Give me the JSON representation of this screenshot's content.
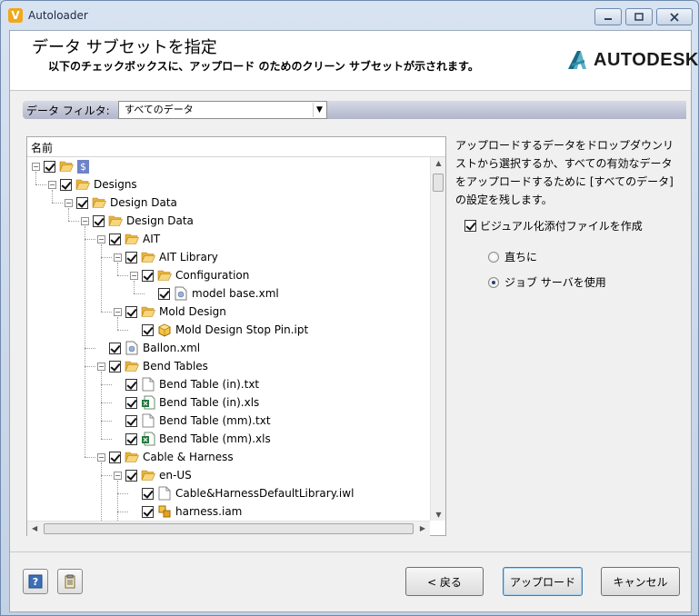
{
  "window": {
    "title": "Autoloader",
    "app_icon_letter": "V"
  },
  "header": {
    "title": "データ サブセットを指定",
    "subtitle": "以下のチェックボックスに、アップロード のためのクリーン サブセットが示されます。",
    "logo_text": "AUTODESK."
  },
  "filter": {
    "label": "データ フィルタ:",
    "selected": "すべてのデータ"
  },
  "tree": {
    "column_header": "名前",
    "nodes": [
      {
        "label": "$",
        "level": 0,
        "icon": "folder-open-icon",
        "expand": "minus"
      },
      {
        "label": "Designs",
        "level": 1,
        "icon": "folder-open-icon",
        "expand": "minus"
      },
      {
        "label": "Design Data",
        "level": 2,
        "icon": "folder-open-icon",
        "expand": "minus"
      },
      {
        "label": "Design Data",
        "level": 3,
        "icon": "folder-open-icon",
        "expand": "minus"
      },
      {
        "label": "AIT",
        "level": 4,
        "icon": "folder-open-icon",
        "expand": "minus"
      },
      {
        "label": "AIT Library",
        "level": 5,
        "icon": "folder-open-icon",
        "expand": "minus"
      },
      {
        "label": "Configuration",
        "level": 6,
        "icon": "folder-open-icon",
        "expand": "minus"
      },
      {
        "label": "model base.xml",
        "level": 7,
        "icon": "xml-file-icon",
        "expand": "none"
      },
      {
        "label": "Mold Design",
        "level": 5,
        "icon": "folder-open-icon",
        "expand": "minus"
      },
      {
        "label": "Mold Design Stop Pin.ipt",
        "level": 6,
        "icon": "part-file-icon",
        "expand": "none"
      },
      {
        "label": "Ballon.xml",
        "level": 4,
        "icon": "xml-file-icon",
        "expand": "none"
      },
      {
        "label": "Bend Tables",
        "level": 4,
        "icon": "folder-open-icon",
        "expand": "minus"
      },
      {
        "label": "Bend Table (in).txt",
        "level": 5,
        "icon": "text-file-icon",
        "expand": "none"
      },
      {
        "label": "Bend Table (in).xls",
        "level": 5,
        "icon": "excel-file-icon",
        "expand": "none"
      },
      {
        "label": "Bend Table (mm).txt",
        "level": 5,
        "icon": "text-file-icon",
        "expand": "none"
      },
      {
        "label": "Bend Table (mm).xls",
        "level": 5,
        "icon": "excel-file-icon",
        "expand": "none"
      },
      {
        "label": "Cable & Harness",
        "level": 4,
        "icon": "folder-open-icon",
        "expand": "minus"
      },
      {
        "label": "en-US",
        "level": 5,
        "icon": "folder-open-icon",
        "expand": "minus"
      },
      {
        "label": "Cable&HarnessDefaultLibrary.iwl",
        "level": 6,
        "icon": "text-file-icon",
        "expand": "none"
      },
      {
        "label": "harness.iam",
        "level": 6,
        "icon": "assembly-file-icon",
        "expand": "none"
      }
    ]
  },
  "description": "アップロードするデータをドロップダウンリストから選択するか、すべての有効なデータをアップロードするために [すべてのデータ] の設定を残します。",
  "options": {
    "visual_attach_label": "ビジュアル化添付ファイルを作成",
    "immediate_label": "直ちに",
    "job_server_label": "ジョブ サーバを使用"
  },
  "buttons": {
    "back": "< 戻る",
    "upload": "アップロード",
    "cancel": "キャンセル"
  },
  "colors": {
    "accent_dollar": "#6f83c8",
    "folder": "#f2c45a"
  }
}
